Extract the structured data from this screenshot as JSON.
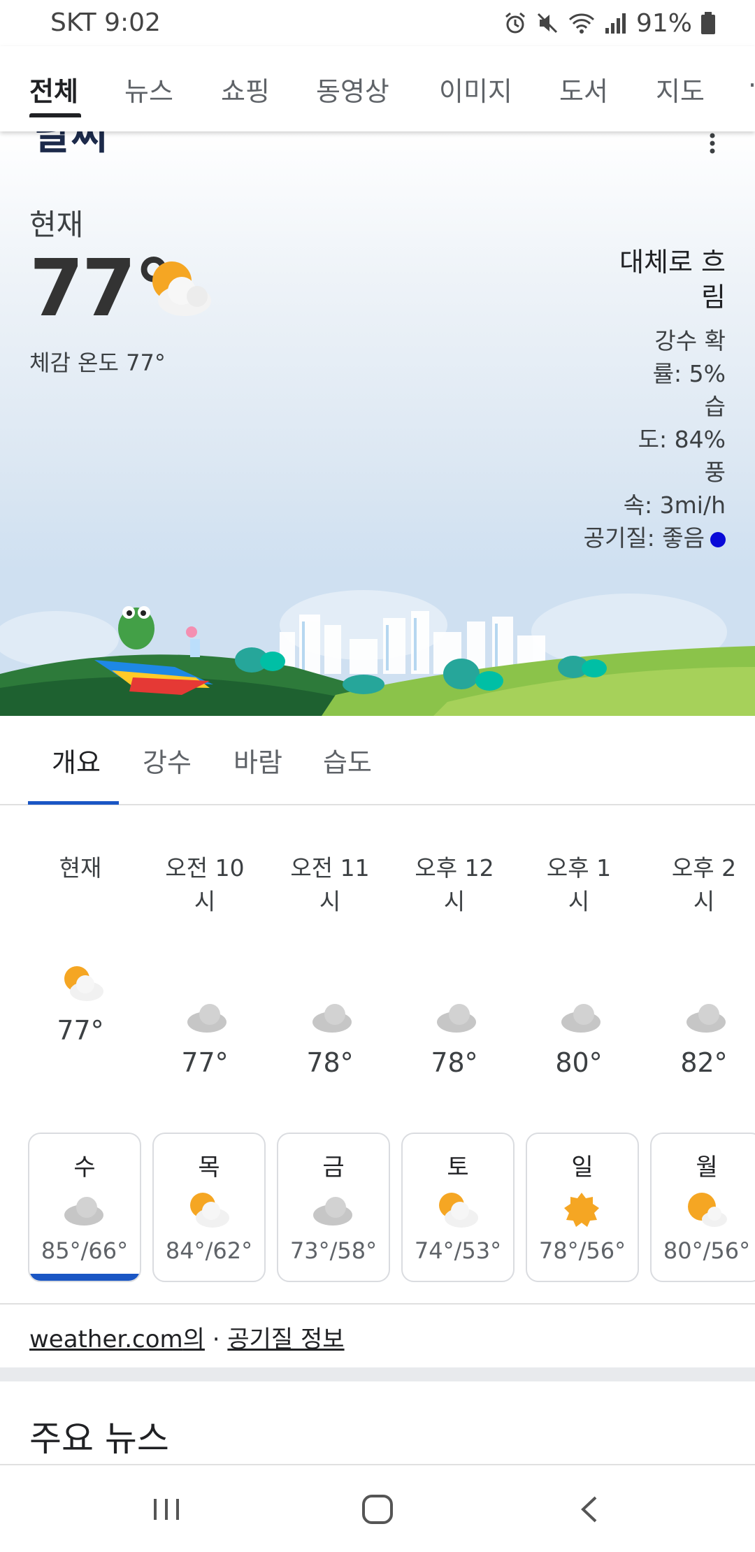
{
  "status_bar": {
    "carrier_time": "SKT 9:02",
    "battery": "91%"
  },
  "top_tabs": [
    "전체",
    "뉴스",
    "쇼핑",
    "동영상",
    "이미지",
    "도서",
    "지도"
  ],
  "weather": {
    "cut_title": "날씨",
    "now_label": "현재",
    "temperature": "77°",
    "feels_like": "체감 온도 77°",
    "condition": [
      "대체로 흐",
      "림"
    ],
    "details": [
      "강수 확",
      "률: 5%",
      "습",
      "도: 84%",
      "풍",
      "속: 3mi/h"
    ],
    "air_quality": "공기질: 좋음",
    "air_quality_color": "#0a0ad8"
  },
  "sub_tabs": [
    "개요",
    "강수",
    "바람",
    "습도"
  ],
  "hourly": [
    {
      "label": [
        "현재"
      ],
      "temp": "77°",
      "icon": "partly-cloudy-icon"
    },
    {
      "label": [
        "오전 10",
        "시"
      ],
      "temp": "77°",
      "icon": "cloudy-icon"
    },
    {
      "label": [
        "오전 11",
        "시"
      ],
      "temp": "78°",
      "icon": "cloudy-icon"
    },
    {
      "label": [
        "오후 12",
        "시"
      ],
      "temp": "78°",
      "icon": "cloudy-icon"
    },
    {
      "label": [
        "오후 1",
        "시"
      ],
      "temp": "80°",
      "icon": "cloudy-icon"
    },
    {
      "label": [
        "오후 2",
        "시"
      ],
      "temp": "82°",
      "icon": "cloudy-icon"
    }
  ],
  "daily": [
    {
      "day": "수",
      "temps": "85°/66°",
      "icon": "cloudy-icon"
    },
    {
      "day": "목",
      "temps": "84°/62°",
      "icon": "partly-cloudy-icon"
    },
    {
      "day": "금",
      "temps": "73°/58°",
      "icon": "cloudy-icon"
    },
    {
      "day": "토",
      "temps": "74°/53°",
      "icon": "partly-cloudy-icon"
    },
    {
      "day": "일",
      "temps": "78°/56°",
      "icon": "sunny-icon"
    },
    {
      "day": "월",
      "temps": "80°/56°",
      "icon": "partly-cloudy-icon"
    }
  ],
  "source": {
    "link": "weather.com",
    "suffix": "의",
    "sep": "·",
    "air_link": "공기질 정보"
  },
  "news_title": "주요 뉴스",
  "colors": {
    "accent": "#1a56c4",
    "sun": "#f5a623"
  }
}
